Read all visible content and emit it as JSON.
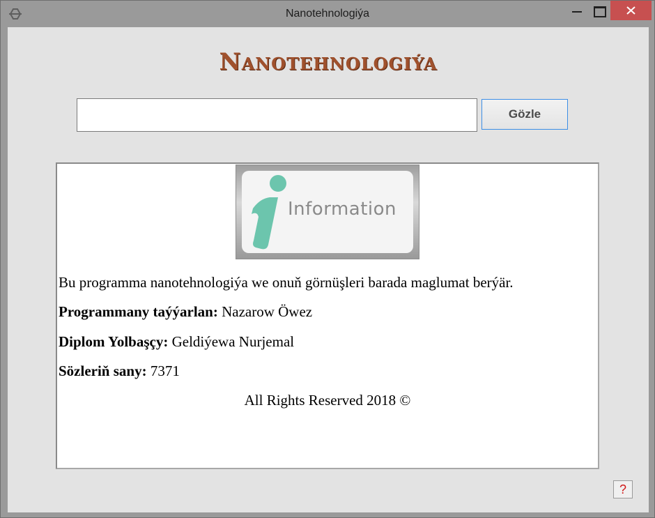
{
  "window": {
    "title": "Nanotehnologiýa"
  },
  "header": {
    "app_title": "Nanotehnologiýa"
  },
  "search": {
    "value": "",
    "placeholder": "",
    "button_label": "Gözle"
  },
  "info_image": {
    "text": "Information",
    "icon": "information-i-icon",
    "accent_color": "#6cc5ad"
  },
  "content": {
    "description": "Bu programma nanotehnologiýa we onuň görnüşleri barada maglumat berýär.",
    "author_label": "Programmany taýýarlan:",
    "author_value": " Nazarow Öwez",
    "supervisor_label": "Diplom Yolbaşçy:",
    "supervisor_value": " Geldiýewa Nurjemal",
    "words_label": "Sözleriň sany:",
    "words_value": " 7371",
    "rights": "All Rights Reserved 2018 ©"
  },
  "help": {
    "label": "?"
  }
}
